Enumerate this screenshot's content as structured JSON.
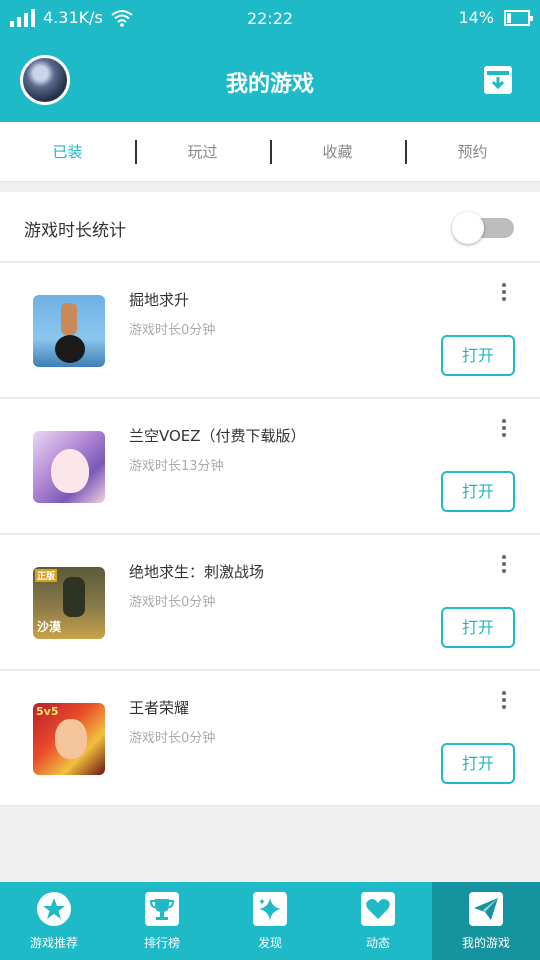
{
  "status_bar": {
    "speed": "4.31K/s",
    "time": "22:22",
    "battery": "14%"
  },
  "header": {
    "title": "我的游戏"
  },
  "tabs": [
    {
      "label": "已装"
    },
    {
      "label": "玩过"
    },
    {
      "label": "收藏"
    },
    {
      "label": "预约"
    }
  ],
  "stats": {
    "label": "游戏时长统计",
    "enabled": false
  },
  "games": [
    {
      "name": "掘地求升",
      "playtime": "游戏时长0分钟",
      "open_label": "打开"
    },
    {
      "name": "兰空VOEZ（付费下载版）",
      "playtime": "游戏时长13分钟",
      "open_label": "打开"
    },
    {
      "name": "绝地求生：刺激战场",
      "playtime": "游戏时长0分钟",
      "open_label": "打开"
    },
    {
      "name": "王者荣耀",
      "playtime": "游戏时长0分钟",
      "open_label": "打开"
    }
  ],
  "icon_badges": {
    "game3_top": "正版",
    "game3_bottom": "沙漠",
    "game4_top": "5v5"
  },
  "bottom_nav": [
    {
      "label": "游戏推荐",
      "icon": "star-icon"
    },
    {
      "label": "排行榜",
      "icon": "trophy-icon"
    },
    {
      "label": "发现",
      "icon": "sparkle-icon"
    },
    {
      "label": "动态",
      "icon": "heart-icon"
    },
    {
      "label": "我的游戏",
      "icon": "paper-plane-icon"
    }
  ],
  "colors": {
    "primary": "#1ebac8",
    "nav_active": "#15949f"
  }
}
